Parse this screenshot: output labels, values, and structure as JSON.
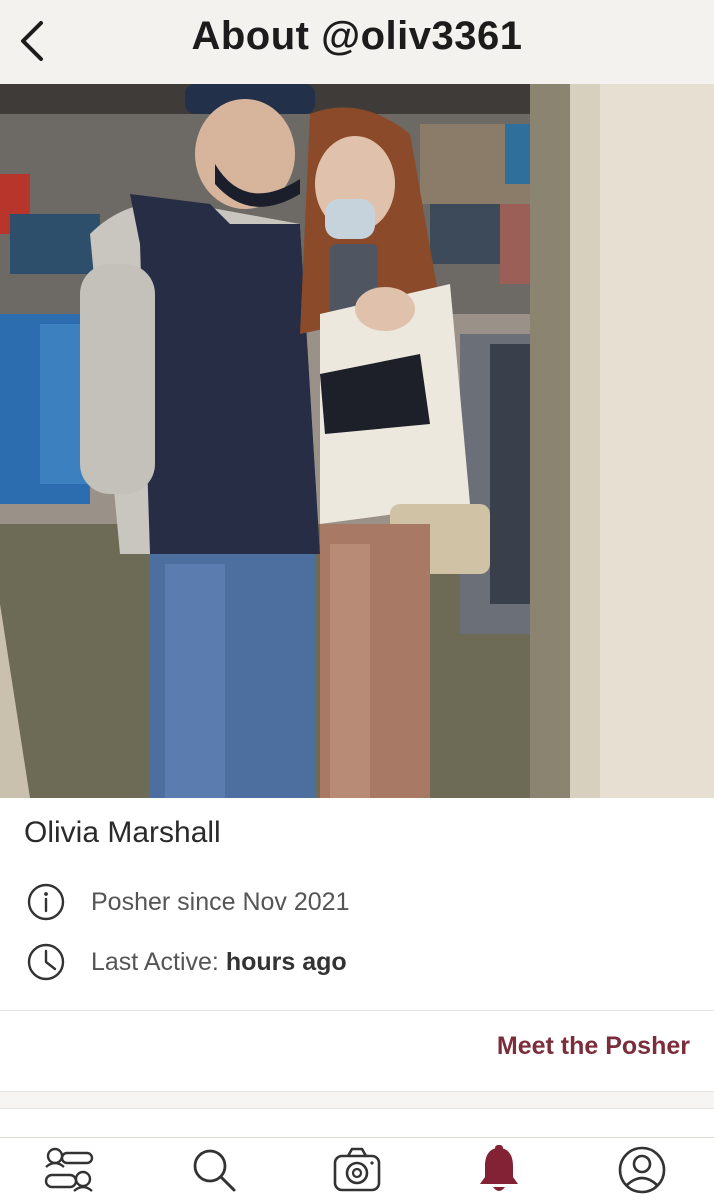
{
  "header": {
    "title": "About @oliv3361",
    "back_icon": "chevron-left-icon"
  },
  "profile": {
    "name": "Olivia Marshall",
    "posher_since": "Posher since Nov 2021",
    "last_active_label": "Last Active:",
    "last_active_value": "hours ago"
  },
  "links": {
    "meet_the_posher": "Meet the Posher"
  },
  "tabbar": {
    "items": [
      {
        "icon": "feed-icon"
      },
      {
        "icon": "search-icon"
      },
      {
        "icon": "camera-icon"
      },
      {
        "icon": "bell-icon"
      },
      {
        "icon": "account-icon"
      }
    ],
    "active_color": "#822234"
  },
  "colors": {
    "accent": "#7b2d3c",
    "header_bg": "#f4f2ef"
  }
}
